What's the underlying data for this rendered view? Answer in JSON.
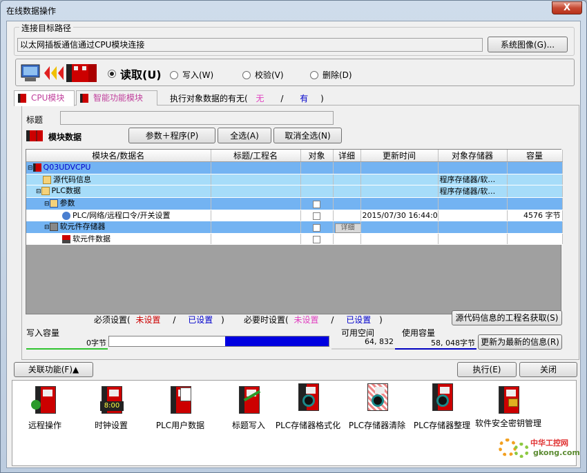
{
  "window": {
    "title": "在线数据操作",
    "close": "X"
  },
  "connection": {
    "group_label": "连接目标路径",
    "path": "以太网插板通信通过CPU模块连接",
    "system_image_btn": "系统图像(G)..."
  },
  "mode": {
    "read": "读取(U)",
    "write": "写入(W)",
    "verify": "校验(V)",
    "delete": "删除(D)",
    "selected": "read"
  },
  "tabs": [
    {
      "label": "CPU模块"
    },
    {
      "label": "智能功能模块"
    }
  ],
  "exec_data": {
    "label": "执行对象数据的有无(",
    "none": "无",
    "slash": "/",
    "have": "有",
    "close": ")"
  },
  "title_field": {
    "label": "标题",
    "value": ""
  },
  "module_data": {
    "label": "模块数据",
    "param_program_btn": "参数＋程序(P)",
    "select_all_btn": "全选(A)",
    "deselect_all_btn": "取消全选(N)"
  },
  "table": {
    "headers": [
      "模块名/数据名",
      "标题/工程名",
      "对象",
      "详细",
      "更新时间",
      "对象存储器",
      "容量"
    ],
    "rows": [
      {
        "name": "Q03UDVCPU",
        "title": "",
        "target": "",
        "detail": "",
        "time": "",
        "memory": "",
        "size": "",
        "style": "sel",
        "indent": 0,
        "checkbox": false
      },
      {
        "name": "源代码信息",
        "title": "",
        "target": "",
        "detail": "",
        "time": "",
        "memory": "程序存储器/软…",
        "size": "",
        "style": "lt",
        "indent": 1,
        "checkbox": false
      },
      {
        "name": "PLC数据",
        "title": "",
        "target": "",
        "detail": "",
        "time": "",
        "memory": "程序存储器/软…",
        "size": "",
        "style": "lt",
        "indent": 1,
        "checkbox": false
      },
      {
        "name": "参数",
        "title": "",
        "target": "",
        "detail": "",
        "time": "",
        "memory": "",
        "size": "",
        "style": "sel",
        "indent": 2,
        "checkbox": true
      },
      {
        "name": "PLC/网络/远程口令/开关设置",
        "title": "",
        "target": "",
        "detail": "",
        "time": "2015/07/30 16:44:04",
        "memory": "",
        "size": "4576 字节",
        "style": "wh",
        "indent": 3,
        "checkbox": true
      },
      {
        "name": "软元件存储器",
        "title": "",
        "target": "",
        "detail": "详细",
        "time": "",
        "memory": "",
        "size": "",
        "style": "sel",
        "indent": 2,
        "checkbox": true
      },
      {
        "name": "软元件数据",
        "title": "",
        "target": "",
        "detail": "",
        "time": "",
        "memory": "",
        "size": "",
        "style": "wh",
        "indent": 3,
        "checkbox": true
      }
    ]
  },
  "legend": {
    "required": "必须设置(",
    "not_set": "未设置",
    "slash": "/",
    "set": "已设置",
    "close": ")",
    "optional": "必要时设置(",
    "opt_not_set": "未设置",
    "opt_set": "已设置"
  },
  "source_name_btn": "源代码信息的工程名获取(S)",
  "capacity": {
    "write_label": "写入容量",
    "write_value": "0字节",
    "available_label": "可用空间",
    "available_value": "64, 832",
    "used_label": "使用容量",
    "used_value": "58, 048字节",
    "used_fraction": 0.472,
    "refresh_btn": "更新为最新的信息(R)"
  },
  "bottom": {
    "related_btn": "关联功能(F)▲",
    "execute_btn": "执行(E)",
    "close_btn": "关闭"
  },
  "functions": [
    {
      "label": "远程操作",
      "icon": "remote-operation-icon"
    },
    {
      "label": "时钟设置",
      "icon": "clock-setting-icon",
      "display": "8:00"
    },
    {
      "label": "PLC用户数据",
      "icon": "plc-user-data-icon"
    },
    {
      "label": "标题写入",
      "icon": "title-write-icon"
    },
    {
      "label": "PLC存储器格式化",
      "icon": "plc-memory-format-icon"
    },
    {
      "label": "PLC存储器清除",
      "icon": "plc-memory-clear-icon"
    },
    {
      "label": "PLC存储器整理",
      "icon": "plc-memory-arrange-icon"
    },
    {
      "label": "软件安全密钥管理",
      "icon": "security-key-icon"
    }
  ],
  "watermark": {
    "line1": "中华工控网",
    "line2": "gkong.com"
  }
}
